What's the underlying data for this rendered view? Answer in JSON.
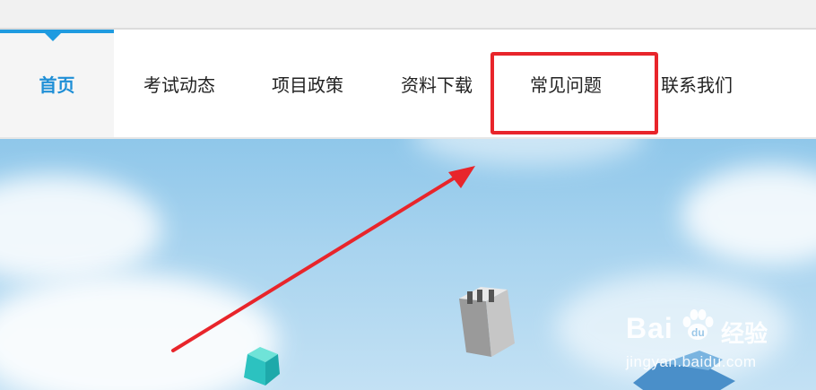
{
  "nav": {
    "items": [
      {
        "label": "首页",
        "active": true
      },
      {
        "label": "考试动态",
        "active": false
      },
      {
        "label": "项目政策",
        "active": false
      },
      {
        "label": "资料下载",
        "active": false
      },
      {
        "label": "常见问题",
        "active": false,
        "highlighted": true
      },
      {
        "label": "联系我们",
        "active": false
      }
    ]
  },
  "colors": {
    "accent": "#1f9be0",
    "active_text": "#1f8fd6",
    "annotation_red": "#e8252b",
    "sky": "#a9d4ef"
  },
  "annotation": {
    "highlight_target": "常见问题",
    "arrow_icon": "red-arrow-annotation"
  },
  "watermark": {
    "brand": "Bai",
    "brand_suffix": "经验",
    "url": "jingyan.baidu.com"
  }
}
